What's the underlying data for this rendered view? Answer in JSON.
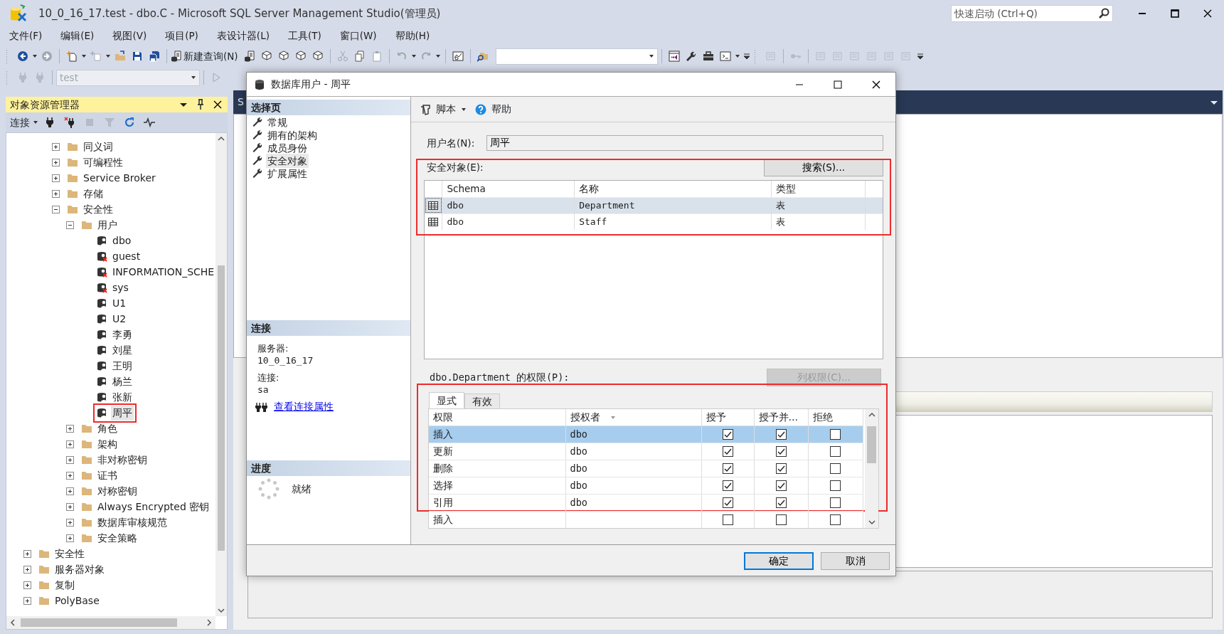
{
  "window": {
    "title": "10_0_16_17.test - dbo.C - Microsoft SQL Server Management Studio(管理员)",
    "quick_launch": {
      "placeholder": "快速启动 (Ctrl+Q)"
    }
  },
  "menu": [
    "文件(F)",
    "编辑(E)",
    "视图(V)",
    "项目(P)",
    "表设计器(L)",
    "工具(T)",
    "窗口(W)",
    "帮助(H)"
  ],
  "toolbar": {
    "new_query": "新建查询(N)",
    "database": "test"
  },
  "explorer": {
    "title": "对象资源管理器",
    "connect": "连接",
    "tree": {
      "inner_items": [
        {
          "label": "同义词",
          "kind": "folder",
          "expanded": false,
          "selected": false,
          "boxed": false
        },
        {
          "label": "可编程性",
          "kind": "folder",
          "expanded": false,
          "selected": false,
          "boxed": false
        },
        {
          "label": "Service Broker",
          "kind": "folder",
          "expanded": false,
          "selected": false,
          "boxed": false
        },
        {
          "label": "存储",
          "kind": "folder",
          "expanded": false,
          "selected": false,
          "boxed": false
        },
        {
          "label": "安全性",
          "kind": "folder",
          "expanded": true,
          "selected": false,
          "boxed": false,
          "children": [
            {
              "label": "用户",
              "kind": "folder",
              "expanded": true,
              "selected": false,
              "boxed": false,
              "children": [
                {
                  "label": "dbo",
                  "kind": "user",
                  "selected": false,
                  "boxed": false
                },
                {
                  "label": "guest",
                  "kind": "user-disabled",
                  "selected": false,
                  "boxed": false
                },
                {
                  "label": "INFORMATION_SCHE",
                  "kind": "user-disabled",
                  "selected": false,
                  "boxed": false
                },
                {
                  "label": "sys",
                  "kind": "user-disabled",
                  "selected": false,
                  "boxed": false
                },
                {
                  "label": "U1",
                  "kind": "user",
                  "selected": false,
                  "boxed": false
                },
                {
                  "label": "U2",
                  "kind": "user",
                  "selected": false,
                  "boxed": false
                },
                {
                  "label": "李勇",
                  "kind": "user",
                  "selected": false,
                  "boxed": false
                },
                {
                  "label": "刘星",
                  "kind": "user",
                  "selected": false,
                  "boxed": false
                },
                {
                  "label": "王明",
                  "kind": "user",
                  "selected": false,
                  "boxed": false
                },
                {
                  "label": "杨兰",
                  "kind": "user",
                  "selected": false,
                  "boxed": false
                },
                {
                  "label": "张新",
                  "kind": "user",
                  "selected": false,
                  "boxed": false
                },
                {
                  "label": "周平",
                  "kind": "user",
                  "selected": true,
                  "boxed": true
                }
              ]
            },
            {
              "label": "角色",
              "kind": "folder",
              "expanded": false,
              "selected": false,
              "boxed": false
            },
            {
              "label": "架构",
              "kind": "folder",
              "expanded": false,
              "selected": false,
              "boxed": false
            },
            {
              "label": "非对称密钥",
              "kind": "folder",
              "expanded": false,
              "selected": false,
              "boxed": false
            },
            {
              "label": "证书",
              "kind": "folder",
              "expanded": false,
              "selected": false,
              "boxed": false
            },
            {
              "label": "对称密钥",
              "kind": "folder",
              "expanded": false,
              "selected": false,
              "boxed": false
            },
            {
              "label": "Always Encrypted 密钥",
              "kind": "folder",
              "expanded": false,
              "selected": false,
              "boxed": false
            },
            {
              "label": "数据库审核规范",
              "kind": "folder",
              "expanded": false,
              "selected": false,
              "boxed": false
            },
            {
              "label": "安全策略",
              "kind": "folder",
              "expanded": false,
              "selected": false,
              "boxed": false
            }
          ]
        }
      ],
      "outer_items": [
        {
          "label": "安全性",
          "kind": "folder",
          "expanded": false,
          "selected": false,
          "boxed": false
        },
        {
          "label": "服务器对象",
          "kind": "folder",
          "expanded": false,
          "selected": false,
          "boxed": false
        },
        {
          "label": "复制",
          "kind": "folder",
          "expanded": false,
          "selected": false,
          "boxed": false
        },
        {
          "label": "PolyBase",
          "kind": "folder",
          "expanded": false,
          "selected": false,
          "boxed": false
        }
      ]
    }
  },
  "document": {
    "tab": "S"
  },
  "dialog": {
    "title": "数据库用户 - 周平",
    "pages_header": "选择页",
    "pages": [
      {
        "label": "常规",
        "selected": false
      },
      {
        "label": "拥有的架构",
        "selected": false
      },
      {
        "label": "成员身份",
        "selected": false
      },
      {
        "label": "安全对象",
        "selected": true
      },
      {
        "label": "扩展属性",
        "selected": false
      }
    ],
    "connection": {
      "header": "连接",
      "server_label": "服务器:",
      "server": "10_0_16_17",
      "login_label": "连接:",
      "login": "sa",
      "link": "查看连接属性"
    },
    "progress": {
      "header": "进度",
      "status": "就绪"
    },
    "toolbar": {
      "script": "脚本",
      "help": "帮助"
    },
    "user_name": {
      "label": "用户名(N):",
      "value": "周平"
    },
    "securables": {
      "label": "安全对象(E):",
      "search_button": "搜索(S)...",
      "boxed": true,
      "columns": [
        "Schema",
        "名称",
        "类型"
      ],
      "rows": [
        {
          "schema": "dbo",
          "name": "Department",
          "type": "表",
          "selected": true
        },
        {
          "schema": "dbo",
          "name": "Staff",
          "type": "表",
          "selected": false
        }
      ]
    },
    "permissions": {
      "label": "dbo.Department 的权限(P):",
      "column_button": {
        "label": "列权限(C)...",
        "disabled": true
      },
      "boxed": true,
      "tabs": [
        {
          "label": "显式",
          "selected": true
        },
        {
          "label": "有效",
          "selected": false
        }
      ],
      "columns": [
        "权限",
        "授权者",
        "授予",
        "授予并…",
        "拒绝"
      ],
      "rows": [
        {
          "permission": "插入",
          "grantor": "dbo",
          "grant": true,
          "with_grant": true,
          "deny": false,
          "selected": true
        },
        {
          "permission": "更新",
          "grantor": "dbo",
          "grant": true,
          "with_grant": true,
          "deny": false,
          "selected": false
        },
        {
          "permission": "删除",
          "grantor": "dbo",
          "grant": true,
          "with_grant": true,
          "deny": false,
          "selected": false
        },
        {
          "permission": "选择",
          "grantor": "dbo",
          "grant": true,
          "with_grant": true,
          "deny": false,
          "selected": false
        },
        {
          "permission": "引用",
          "grantor": "dbo",
          "grant": true,
          "with_grant": true,
          "deny": false,
          "selected": false
        },
        {
          "permission": "插入",
          "grant": false,
          "with_grant": false,
          "deny": false,
          "selected": false
        }
      ]
    },
    "buttons": [
      {
        "label": "确定",
        "default": true
      },
      {
        "label": "取消",
        "default": false
      }
    ]
  }
}
